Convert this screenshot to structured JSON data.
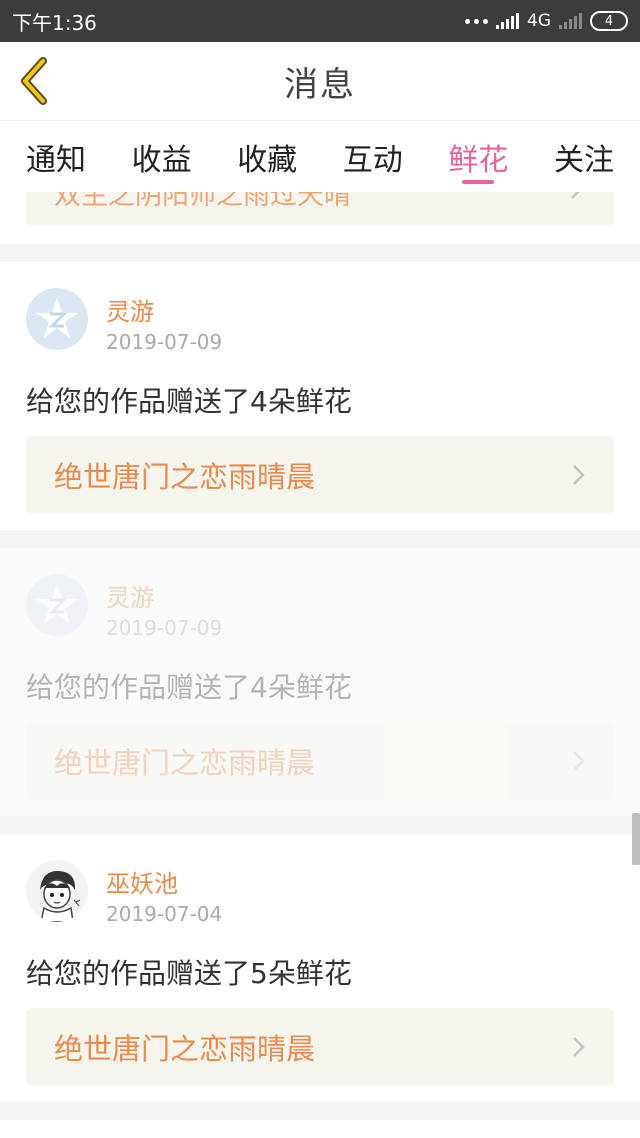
{
  "status_bar": {
    "time": "下午1:36",
    "network": "4G",
    "battery": "4"
  },
  "header": {
    "title": "消息"
  },
  "tabs": [
    {
      "label": "通知",
      "active": false
    },
    {
      "label": "收益",
      "active": false
    },
    {
      "label": "收藏",
      "active": false
    },
    {
      "label": "互动",
      "active": false
    },
    {
      "label": "鲜花",
      "active": true
    },
    {
      "label": "关注",
      "active": false
    }
  ],
  "partial_item": {
    "work_title": "双生之阴阳师之雨过天晴"
  },
  "messages": [
    {
      "user": "灵游",
      "date": "2019-07-09",
      "message": "给您的作品赠送了4朵鲜花",
      "work_title": "绝世唐门之恋雨晴晨",
      "avatar": "default-avatar"
    },
    {
      "user": "灵游",
      "date": "2019-07-09",
      "message": "给您的作品赠送了4朵鲜花",
      "work_title": "绝世唐门之恋雨晴晨",
      "avatar": "default-avatar"
    },
    {
      "user": "巫妖池",
      "date": "2019-07-04",
      "message": "给您的作品赠送了5朵鲜花",
      "work_title": "绝世唐门之恋雨晴晨",
      "avatar": "sketch-avatar"
    }
  ],
  "colors": {
    "accent": "#e5649e",
    "orange": "#ec8a4d",
    "status_bar": "#3c3c3c"
  }
}
